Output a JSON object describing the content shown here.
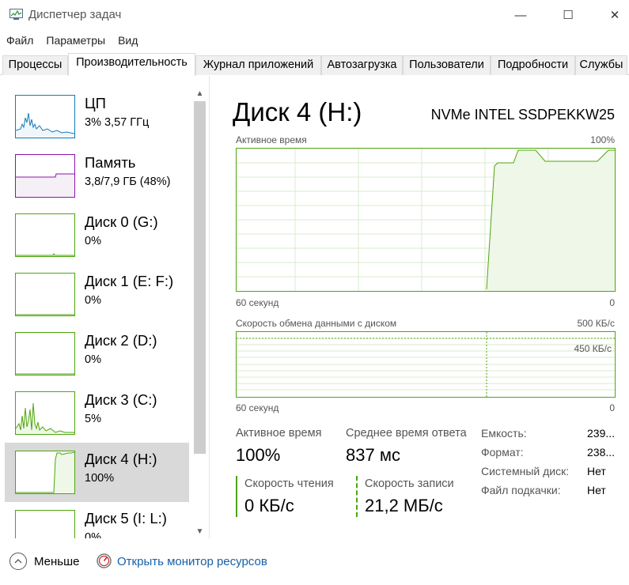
{
  "window": {
    "title": "Диспетчер задач",
    "controls": {
      "minimize": "—",
      "maximize": "☐",
      "close": "✕"
    }
  },
  "menu": [
    "Файл",
    "Параметры",
    "Вид"
  ],
  "tabs": [
    {
      "label": "Процессы",
      "active": false
    },
    {
      "label": "Производительность",
      "active": true
    },
    {
      "label": "Журнал приложений",
      "active": false
    },
    {
      "label": "Автозагрузка",
      "active": false
    },
    {
      "label": "Пользователи",
      "active": false
    },
    {
      "label": "Подробности",
      "active": false
    },
    {
      "label": "Службы",
      "active": false
    }
  ],
  "sidebar": {
    "items": [
      {
        "name": "ЦП",
        "value": "3%  3,57 ГГц",
        "color": "#117dbb"
      },
      {
        "name": "Память",
        "value": "3,8/7,9 ГБ (48%)",
        "color": "#8b12ae"
      },
      {
        "name": "Диск 0 (G:)",
        "value": "0%",
        "color": "#4da60c"
      },
      {
        "name": "Диск 1 (E: F:)",
        "value": "0%",
        "color": "#4da60c"
      },
      {
        "name": "Диск 2 (D:)",
        "value": "0%",
        "color": "#4da60c"
      },
      {
        "name": "Диск 3 (C:)",
        "value": "5%",
        "color": "#4da60c"
      },
      {
        "name": "Диск 4 (H:)",
        "value": "100%",
        "color": "#4da60c",
        "selected": true
      },
      {
        "name": "Диск 5 (I: L:)",
        "value": "0%",
        "color": "#4da60c"
      }
    ]
  },
  "main": {
    "title": "Диск 4 (H:)",
    "model": "NVMe INTEL SSDPEKKW25",
    "active_chart": {
      "label": "Активное время",
      "max_label": "100%",
      "x_left": "60 секунд",
      "x_right": "0"
    },
    "transfer_chart": {
      "label": "Скорость обмена данными с диском",
      "max_label": "500 КБ/с",
      "ref_label": "450 КБ/с",
      "x_left": "60 секунд",
      "x_right": "0"
    },
    "stats": {
      "active_time_label": "Активное время",
      "active_time_value": "100%",
      "response_label": "Среднее время ответа",
      "response_value": "837 мс",
      "read_label": "Скорость чтения",
      "read_value": "0 КБ/с",
      "write_label": "Скорость записи",
      "write_value": "21,2 МБ/с"
    },
    "info": [
      {
        "label": "Емкость:",
        "value": "239..."
      },
      {
        "label": "Формат:",
        "value": "238..."
      },
      {
        "label": "Системный диск:",
        "value": "Нет"
      },
      {
        "label": "Файл подкачки:",
        "value": "Нет"
      }
    ]
  },
  "footer": {
    "fewer_label": "Меньше",
    "monitor_link": "Открыть монитор ресурсов"
  },
  "colors": {
    "disk": "#4da60c",
    "disk_fill": "#eff7e8",
    "cpu": "#117dbb",
    "memory": "#8b12ae",
    "link": "#1560a8"
  }
}
